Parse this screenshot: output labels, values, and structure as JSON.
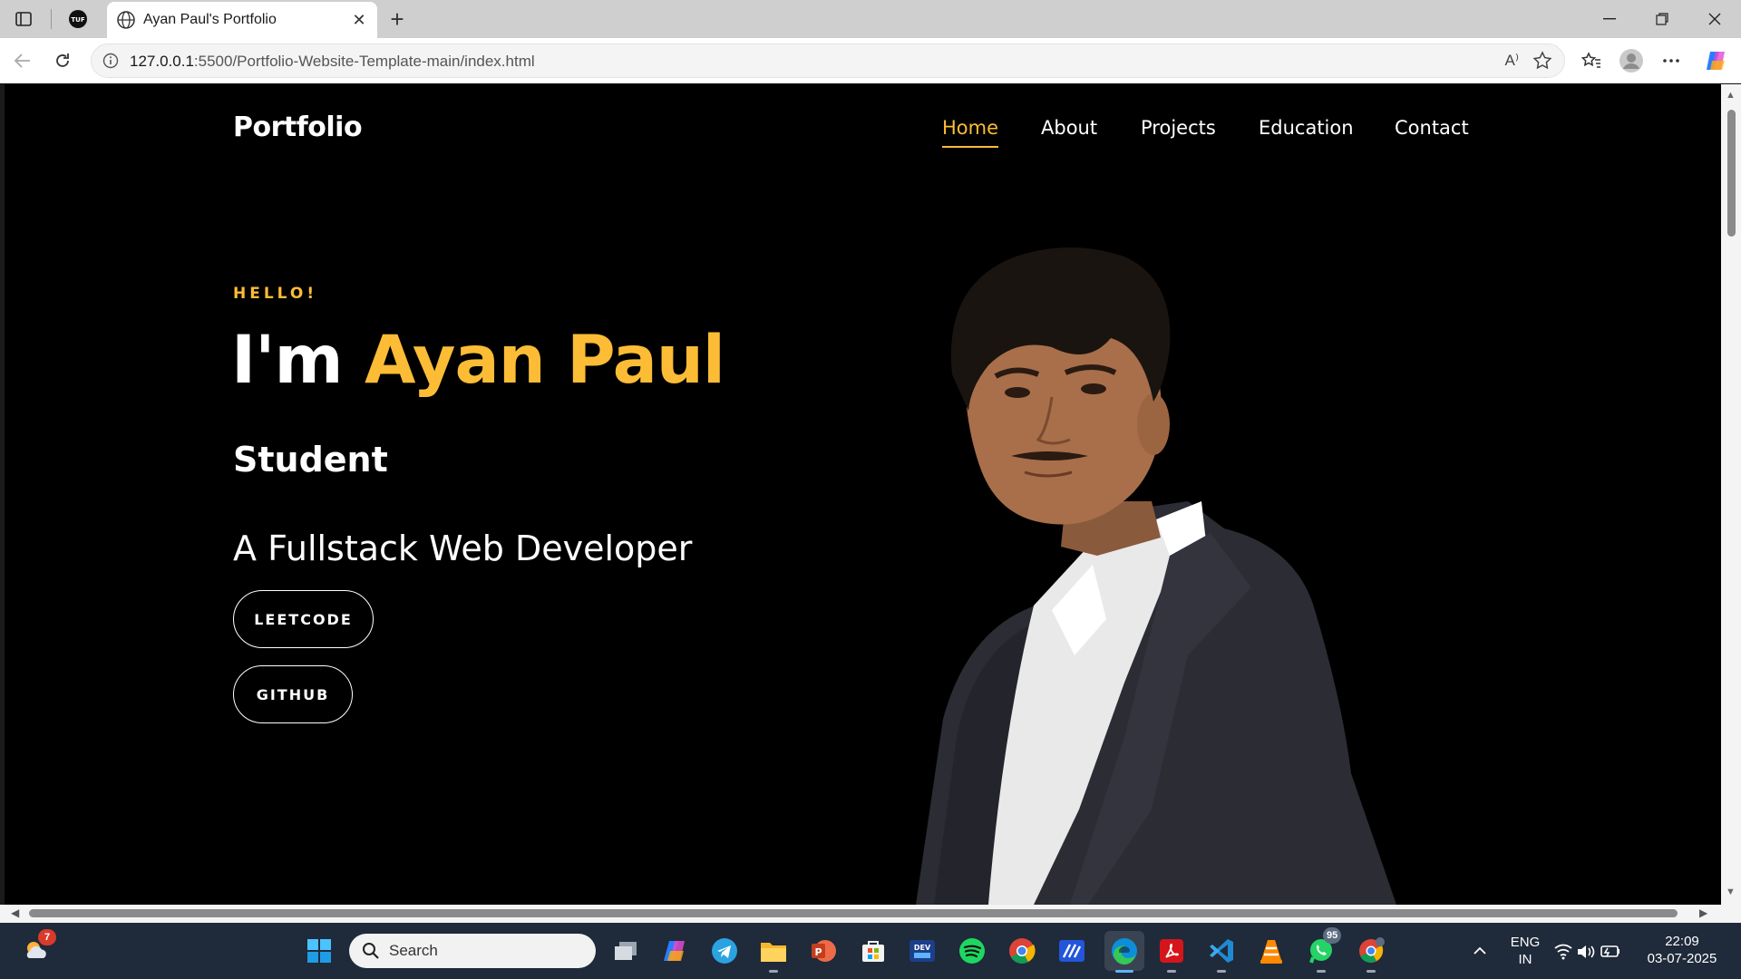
{
  "browser": {
    "tab_title": "Ayan Paul's Portfolio",
    "url_host": "127.0.0.1",
    "url_path": ":5500/Portfolio-Website-Template-main/index.html",
    "read_aloud_label": "A⁾"
  },
  "site": {
    "logo": "Portfolio",
    "nav": [
      "Home",
      "About",
      "Projects",
      "Education",
      "Contact"
    ],
    "active_nav": "Home",
    "hero": {
      "greeting": "HELLO!",
      "intro": "I'm ",
      "name": "Ayan Paul",
      "role": "Student",
      "tagline": "A Fullstack Web Developer",
      "buttons": [
        "LEETCODE",
        "GITHUB"
      ]
    },
    "colors": {
      "accent": "#fcbc36",
      "background": "#000000",
      "text": "#ffffff"
    }
  },
  "taskbar": {
    "search_placeholder": "Search",
    "weather_badge": "7",
    "whatsapp_badge": "95",
    "language": "ENG",
    "region": "IN",
    "time": "22:09",
    "date": "03-07-2025",
    "icons": [
      "weather-icon",
      "start-icon",
      "task-view-icon",
      "copilot-icon",
      "telegram-icon",
      "file-explorer-icon",
      "powerpoint-icon",
      "ms-store-icon",
      "dev-home-icon",
      "spotify-icon",
      "chrome-icon",
      "app-icon",
      "edge-icon",
      "acrobat-icon",
      "vscode-icon",
      "vlc-icon",
      "whatsapp-icon",
      "chrome-profile-icon"
    ]
  }
}
